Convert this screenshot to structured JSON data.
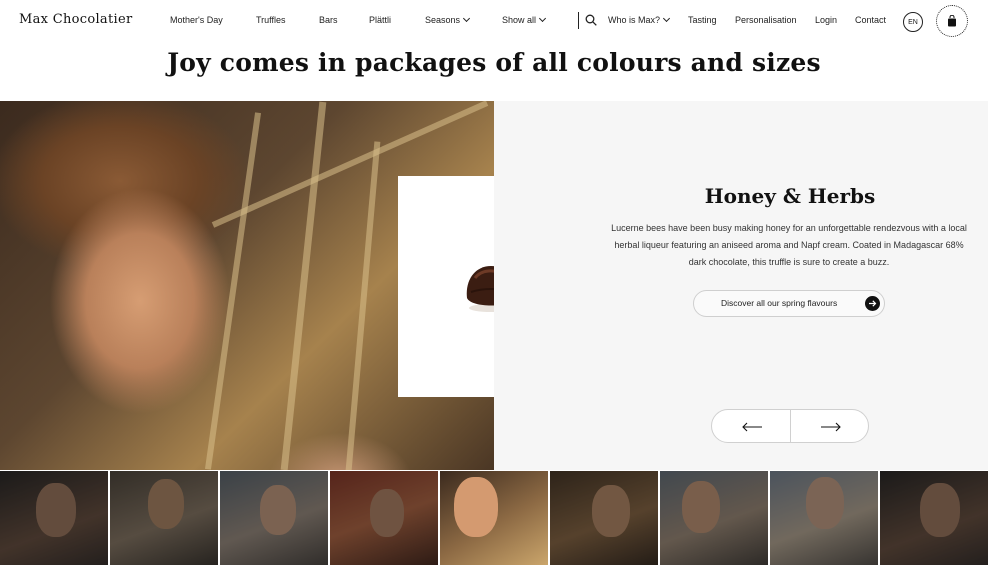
{
  "brand": {
    "logo": "Max Chocolatier"
  },
  "nav": {
    "items": [
      {
        "label": "Mother's Day",
        "dropdown": false
      },
      {
        "label": "Truffles",
        "dropdown": false
      },
      {
        "label": "Bars",
        "dropdown": false
      },
      {
        "label": "Plättli",
        "dropdown": false
      },
      {
        "label": "Seasons",
        "dropdown": true
      },
      {
        "label": "Show all",
        "dropdown": true
      }
    ],
    "secondary": [
      {
        "label": "Who is Max?",
        "dropdown": true
      },
      {
        "label": "Tasting",
        "dropdown": false
      },
      {
        "label": "Personalisation",
        "dropdown": false
      },
      {
        "label": "Login",
        "dropdown": false
      },
      {
        "label": "Contact",
        "dropdown": false
      }
    ],
    "language": "EN",
    "icons": {
      "search": "search-icon",
      "cart": "shopping-bag-icon"
    }
  },
  "headline": "Joy comes in packages of all colours and sizes",
  "feature": {
    "title": "Honey & Herbs",
    "description": "Lucerne bees have been busy making honey for an unforgettable rendezvous with a local herbal liqueur featuring an aniseed aroma and Napf cream. Coated in Madagascar 68% dark chocolate, this truffle is sure to create a buzz.",
    "cta_label": "Discover all our spring flavours",
    "cta_icon": "arrow-right-icon"
  },
  "pager": {
    "prev_icon": "arrow-left-icon",
    "next_icon": "arrow-right-icon"
  },
  "thumbnails": {
    "count": 9,
    "active_index": 4
  },
  "colors": {
    "panel_bg": "#f6f6f6",
    "text": "#111111",
    "border": "#d0d0d0"
  }
}
